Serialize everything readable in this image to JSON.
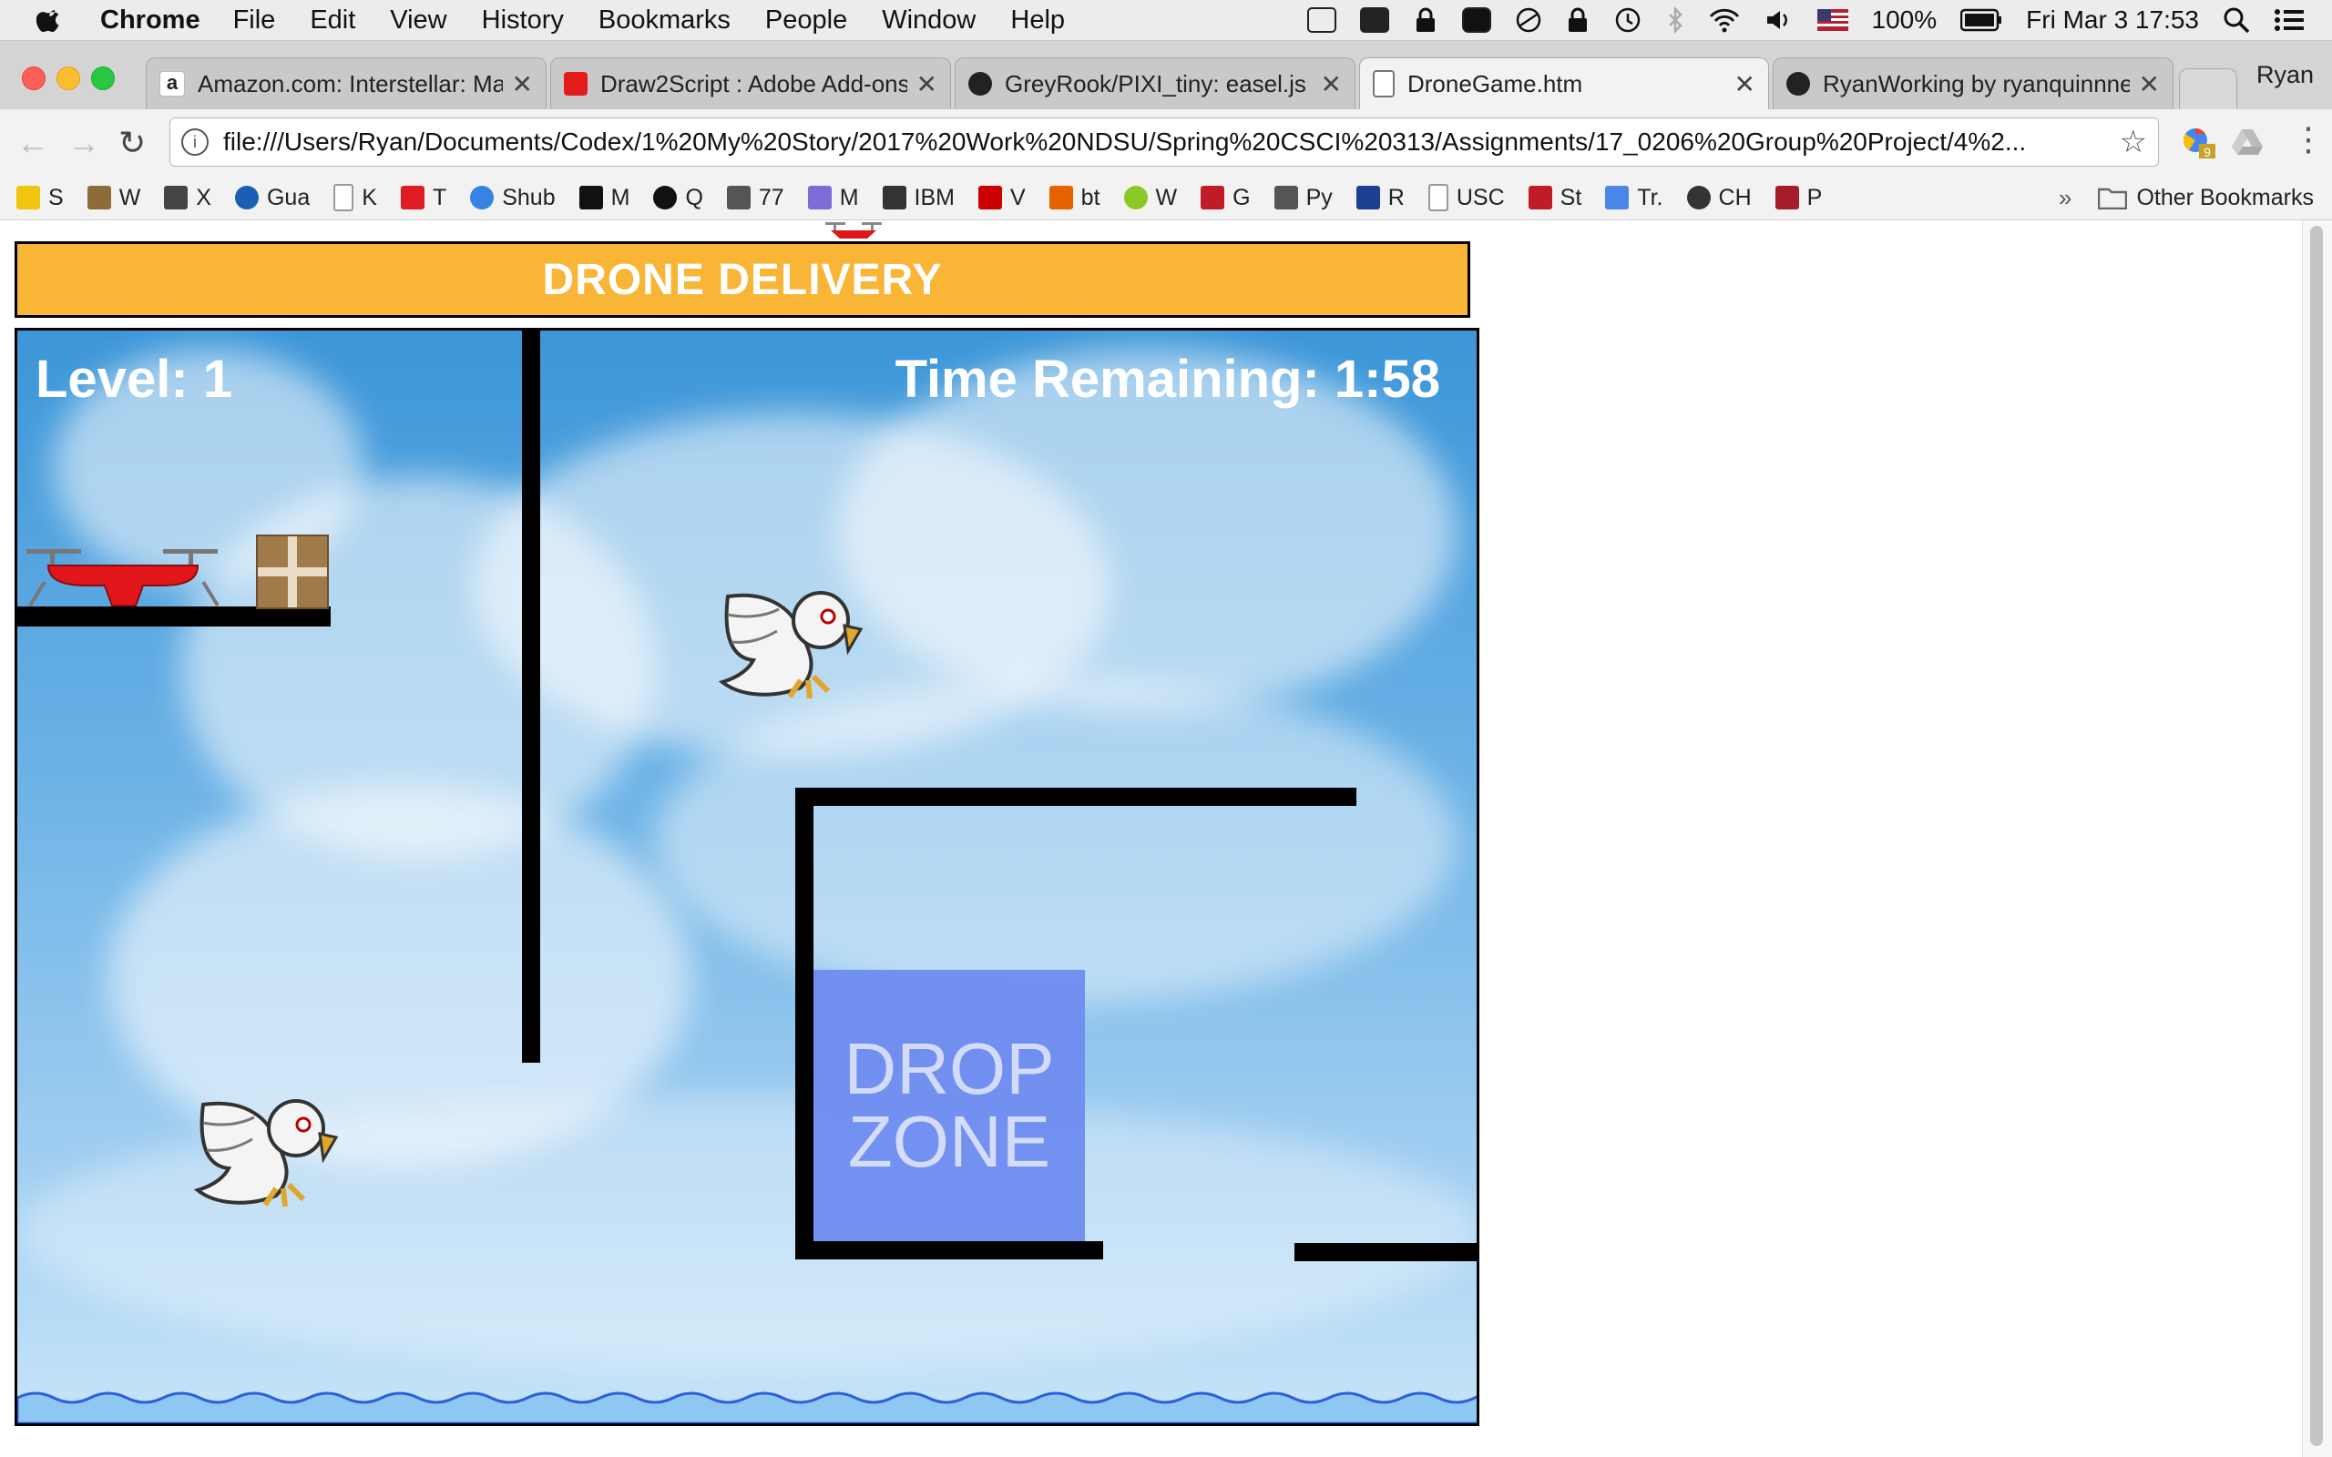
{
  "menubar": {
    "app_name": "Chrome",
    "items": [
      "File",
      "Edit",
      "View",
      "History",
      "Bookmarks",
      "People",
      "Window",
      "Help"
    ],
    "battery": "100%",
    "datetime": "Fri Mar 3  17:53"
  },
  "tabs": [
    {
      "title": "Amazon.com: Interstellar: Mat",
      "favicon": "amazon-icon",
      "active": false
    },
    {
      "title": "Draw2Script : Adobe Add-ons",
      "favicon": "adobe-icon",
      "active": false
    },
    {
      "title": "GreyRook/PIXI_tiny: easel.js g",
      "favicon": "github-icon",
      "active": false
    },
    {
      "title": "DroneGame.htm",
      "favicon": "document-icon",
      "active": true
    },
    {
      "title": "RyanWorking by ryanquinnnel",
      "favicon": "github-icon",
      "active": false
    }
  ],
  "profile_name": "Ryan",
  "address_bar": {
    "url": "file:///Users/Ryan/Documents/Codex/1%20My%20Story/2017%20Work%20NDSU/Spring%20CSCI%20313/Assignments/17_0206%20Group%20Project/4%2..."
  },
  "bookmarks": [
    {
      "label": "S",
      "color": "#f1c40f"
    },
    {
      "label": "W",
      "color": "#8e6b3a"
    },
    {
      "label": "X",
      "color": "#444444"
    },
    {
      "label": "Gua",
      "color": "#1a5fb4"
    },
    {
      "label": "K",
      "color": "#999999"
    },
    {
      "label": "T",
      "color": "#e01b24"
    },
    {
      "label": "Shub",
      "color": "#3584e4"
    },
    {
      "label": "M",
      "color": "#111111"
    },
    {
      "label": "Q",
      "color": "#111111"
    },
    {
      "label": "77",
      "color": "#555555"
    },
    {
      "label": "M",
      "color": "#7d6bd8"
    },
    {
      "label": "IBM",
      "color": "#333333"
    },
    {
      "label": "V",
      "color": "#cc0000"
    },
    {
      "label": "bt",
      "color": "#e66100"
    },
    {
      "label": "W",
      "color": "#8ac926"
    },
    {
      "label": "G",
      "color": "#c01c28"
    },
    {
      "label": "Py",
      "color": "#555555"
    },
    {
      "label": "R",
      "color": "#1c3f94"
    },
    {
      "label": "USC",
      "color": "#999999"
    },
    {
      "label": "St",
      "color": "#c01c28"
    },
    {
      "label": "Tr.",
      "color": "#4a86e8"
    },
    {
      "label": "CH",
      "color": "#333333"
    },
    {
      "label": "P",
      "color": "#a51d2d"
    }
  ],
  "other_bookmarks": "Other Bookmarks",
  "game": {
    "title": "DRONE DELIVERY",
    "level_text": "Level: 1",
    "time_text": "Time Remaining: 1:58",
    "drop_zone_line1": "DROP",
    "drop_zone_line2": "ZONE"
  },
  "colors": {
    "header_orange": "#f9b535",
    "drone_red": "#e0161b",
    "drop_zone_blue": "#6f8df0"
  }
}
